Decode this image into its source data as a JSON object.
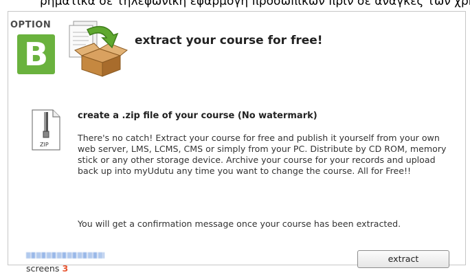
{
  "top_strip_text": "ρηματικά σε τηλεφωνική εφαρμογή προσωπικών πριν σε ανάγκες των χρηστών στην",
  "option": {
    "label": "OPTION",
    "letter": "B"
  },
  "heading": "extract your course for free!",
  "zip": {
    "icon_label": "ZIP",
    "title": "create a .zip file of your course (No watermark)",
    "description": "There's no catch! Extract your course for free and publish it yourself from your own web server, LMS, LCMS, CMS or simply from your PC. Distribute by CD ROM, memory stick or any other storage device. Archive your course for your records and upload back up into myUdutu any time you want to change the course. All for Free!!"
  },
  "confirmation": "You will get a confirmation message once your course has been extracted.",
  "footer": {
    "screens_label": "screens",
    "screens_count": "3"
  },
  "extract_button": "extract",
  "colors": {
    "option_green": "#6ab23e",
    "count_orange": "#e8542f",
    "arrow_green": "#5fa82f"
  }
}
